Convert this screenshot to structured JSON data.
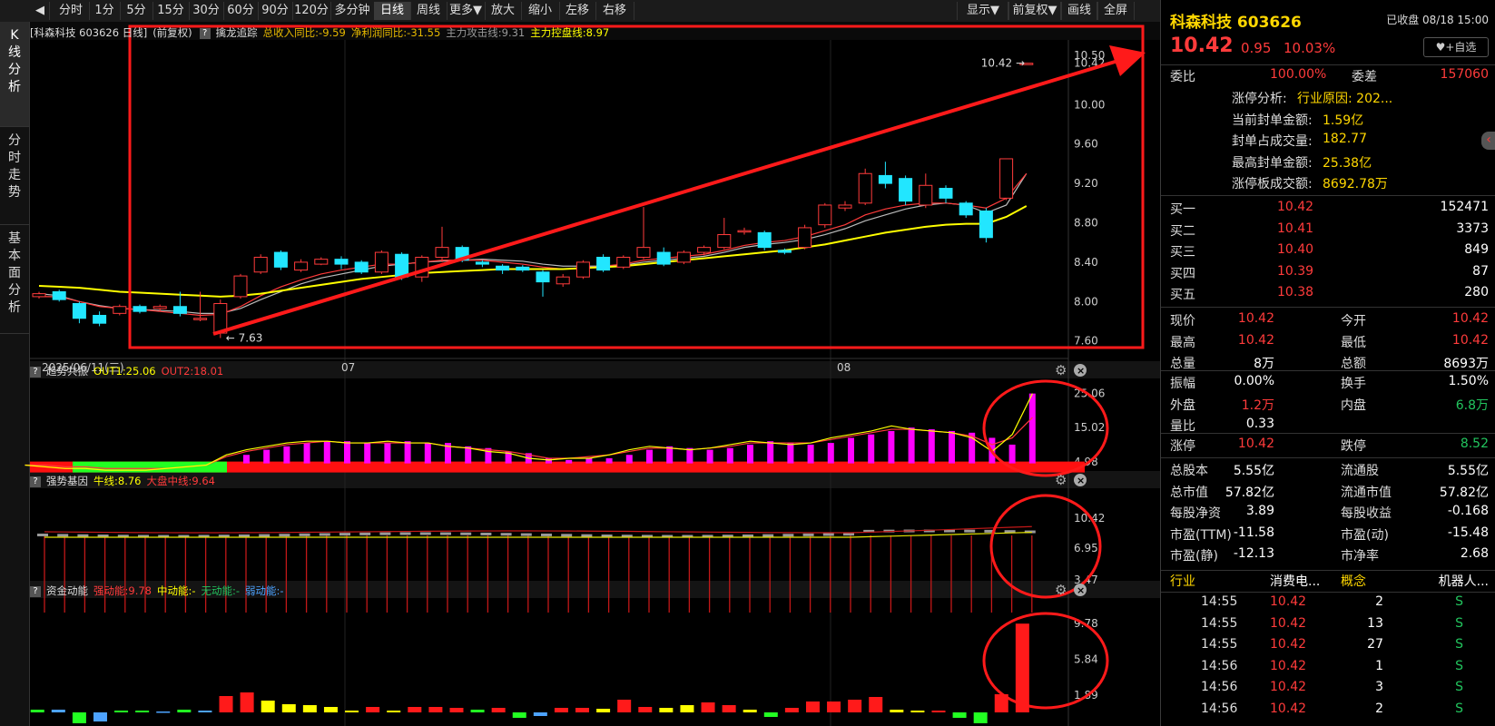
{
  "toolbar": {
    "back_icon": "◀",
    "items": [
      "分时",
      "1分",
      "5分",
      "15分",
      "30分",
      "60分",
      "90分",
      "120分",
      "多分钟",
      "日线",
      "周线",
      "更多▼",
      "放大",
      "缩小",
      "左移",
      "右移"
    ],
    "active": "日线",
    "right_items": [
      "显示▼",
      "前复权▼",
      "画线",
      "全屏"
    ]
  },
  "sidenav": {
    "items": [
      "K线分析",
      "分时走势",
      "基本面分析"
    ]
  },
  "kline": {
    "header": {
      "name": "[科森科技 603626 日线]",
      "fq": "(前复权)",
      "help": "?",
      "indicator": "擒龙追踪",
      "fields": [
        {
          "label": "总收入同比:",
          "value": "-9.59",
          "color": "#e6b800"
        },
        {
          "label": "净利润同比:",
          "value": "-31.55",
          "color": "#e6b800"
        },
        {
          "label": "主力攻击线:",
          "value": "9.31",
          "color": "#999999"
        },
        {
          "label": "主力控盘线:",
          "value": "8.97",
          "color": "#ffff00"
        }
      ]
    },
    "y_ticks": [
      "10.50",
      "10.42",
      "10.00",
      "9.60",
      "9.20",
      "8.80",
      "8.40",
      "8.00",
      "7.60"
    ],
    "x_labels": [
      "2025/06/11(三)",
      "07",
      "08"
    ],
    "max_label": "10.42",
    "min_label": "7.63",
    "ylim": [
      7.45,
      10.62
    ],
    "candles": [
      [
        8.05,
        8.08,
        8.03,
        8.1
      ],
      [
        8.1,
        8.02,
        8.0,
        8.12
      ],
      [
        7.98,
        7.83,
        7.78,
        8.0
      ],
      [
        7.86,
        7.78,
        7.75,
        7.9
      ],
      [
        7.88,
        7.95,
        7.86,
        7.97
      ],
      [
        7.95,
        7.9,
        7.88,
        7.97
      ],
      [
        7.93,
        7.95,
        7.9,
        7.97
      ],
      [
        7.95,
        7.88,
        7.85,
        8.1
      ],
      [
        7.82,
        7.83,
        7.8,
        8.1
      ],
      [
        7.68,
        7.98,
        7.63,
        8.02
      ],
      [
        8.05,
        8.26,
        8.03,
        8.28
      ],
      [
        8.3,
        8.45,
        8.28,
        8.48
      ],
      [
        8.5,
        8.35,
        8.32,
        8.52
      ],
      [
        8.32,
        8.4,
        8.3,
        8.43
      ],
      [
        8.38,
        8.43,
        8.37,
        8.45
      ],
      [
        8.43,
        8.38,
        8.33,
        8.46
      ],
      [
        8.4,
        8.3,
        8.28,
        8.42
      ],
      [
        8.3,
        8.5,
        8.28,
        8.52
      ],
      [
        8.48,
        8.25,
        8.22,
        8.5
      ],
      [
        8.25,
        8.45,
        8.2,
        8.47
      ],
      [
        8.45,
        8.55,
        8.4,
        8.76
      ],
      [
        8.55,
        8.42,
        8.4,
        8.57
      ],
      [
        8.4,
        8.38,
        8.35,
        8.42
      ],
      [
        8.36,
        8.32,
        8.28,
        8.38
      ],
      [
        8.35,
        8.32,
        8.3,
        8.37
      ],
      [
        8.3,
        8.2,
        8.05,
        8.32
      ],
      [
        8.18,
        8.25,
        8.15,
        8.28
      ],
      [
        8.25,
        8.4,
        8.23,
        8.42
      ],
      [
        8.45,
        8.32,
        8.3,
        8.48
      ],
      [
        8.35,
        8.45,
        8.33,
        8.47
      ],
      [
        8.45,
        8.55,
        8.43,
        8.96
      ],
      [
        8.5,
        8.38,
        8.36,
        8.55
      ],
      [
        8.4,
        8.5,
        8.38,
        8.52
      ],
      [
        8.5,
        8.55,
        8.47,
        8.57
      ],
      [
        8.55,
        8.68,
        8.53,
        8.85
      ],
      [
        8.72,
        8.72,
        8.68,
        8.75
      ],
      [
        8.7,
        8.55,
        8.52,
        8.72
      ],
      [
        8.52,
        8.5,
        8.48,
        8.54
      ],
      [
        8.55,
        8.75,
        8.53,
        8.78
      ],
      [
        8.78,
        8.98,
        8.75,
        9.0
      ],
      [
        8.95,
        8.98,
        8.92,
        9.02
      ],
      [
        9.0,
        9.3,
        8.98,
        9.35
      ],
      [
        9.28,
        9.2,
        9.15,
        9.42
      ],
      [
        9.25,
        9.02,
        8.98,
        9.28
      ],
      [
        8.98,
        9.18,
        8.95,
        9.3
      ],
      [
        9.15,
        9.05,
        9.0,
        9.18
      ],
      [
        9.0,
        8.88,
        8.85,
        9.02
      ],
      [
        8.92,
        8.65,
        8.6,
        8.95
      ],
      [
        9.05,
        9.45,
        9.03,
        9.45
      ],
      [
        10.42,
        10.42,
        10.42,
        10.42
      ]
    ],
    "ma_white": [
      8.08,
      8.06,
      8.0,
      7.96,
      7.93,
      7.92,
      7.91,
      7.9,
      7.88,
      7.88,
      7.93,
      8.02,
      8.1,
      8.18,
      8.24,
      8.28,
      8.32,
      8.36,
      8.38,
      8.4,
      8.41,
      8.42,
      8.43,
      8.42,
      8.41,
      8.38,
      8.36,
      8.36,
      8.36,
      8.37,
      8.4,
      8.42,
      8.44,
      8.46,
      8.5,
      8.55,
      8.58,
      8.6,
      8.63,
      8.68,
      8.74,
      8.82,
      8.88,
      8.94,
      8.98,
      9.0,
      8.98,
      8.9,
      8.98,
      9.3
    ],
    "ma_red": [
      8.05,
      8.05,
      8.0,
      7.95,
      7.93,
      7.92,
      7.9,
      7.88,
      7.86,
      7.87,
      7.95,
      8.06,
      8.15,
      8.22,
      8.28,
      8.32,
      8.35,
      8.38,
      8.38,
      8.4,
      8.42,
      8.42,
      8.42,
      8.4,
      8.38,
      8.35,
      8.33,
      8.34,
      8.36,
      8.38,
      8.42,
      8.44,
      8.46,
      8.48,
      8.52,
      8.57,
      8.6,
      8.62,
      8.66,
      8.72,
      8.78,
      8.88,
      8.94,
      8.98,
      9.0,
      9.0,
      8.98,
      8.95,
      9.05,
      9.3
    ],
    "ma_yellow": [
      8.16,
      8.15,
      8.14,
      8.12,
      8.1,
      8.09,
      8.08,
      8.07,
      8.06,
      8.05,
      8.06,
      8.08,
      8.11,
      8.14,
      8.17,
      8.2,
      8.23,
      8.25,
      8.27,
      8.29,
      8.3,
      8.31,
      8.32,
      8.33,
      8.33,
      8.33,
      8.33,
      8.34,
      8.35,
      8.36,
      8.38,
      8.4,
      8.42,
      8.44,
      8.46,
      8.48,
      8.5,
      8.52,
      8.55,
      8.58,
      8.62,
      8.66,
      8.7,
      8.73,
      8.76,
      8.78,
      8.79,
      8.79,
      8.86,
      8.97
    ]
  },
  "panel2": {
    "help": "?",
    "title": "趋势共振",
    "fields": [
      {
        "label": "OUT1:",
        "value": "25.06",
        "color": "#ffff00"
      },
      {
        "label": "OUT2:",
        "value": "18.01",
        "color": "#ff3b3b"
      }
    ],
    "y_ticks": [
      "25.06",
      "15.02",
      "4.98"
    ],
    "ylim": [
      2,
      26.5
    ],
    "bars": [
      4,
      4,
      4,
      4,
      4,
      4,
      4,
      4,
      4,
      4,
      7,
      8.5,
      9.5,
      10.5,
      11,
      11,
      10.5,
      10.5,
      11,
      10.5,
      10.5,
      9.5,
      9,
      8,
      7.5,
      6,
      5.5,
      6,
      6,
      7,
      8.5,
      9.5,
      9,
      8.5,
      9,
      10,
      11,
      10.5,
      10,
      10.5,
      12,
      13,
      14,
      15,
      14.5,
      14,
      13.5,
      12,
      10,
      25
    ],
    "out1": [
      4,
      3.5,
      3,
      3,
      2.5,
      2.5,
      2.5,
      3,
      3.5,
      4,
      7,
      8.5,
      9.5,
      10.5,
      11,
      11,
      10.5,
      10.5,
      11,
      10.5,
      10.5,
      9.5,
      9,
      8,
      7.5,
      6,
      5.5,
      6,
      6,
      7,
      8.5,
      9.5,
      9,
      8.5,
      9,
      10,
      11,
      10.5,
      10,
      10.5,
      12,
      13,
      14,
      15.5,
      14.5,
      14,
      13.5,
      12,
      8,
      13,
      25
    ],
    "out2": [
      4,
      4,
      3.5,
      3.5,
      3,
      3,
      3,
      3,
      3.5,
      4,
      6.5,
      8,
      9,
      10,
      10.5,
      11,
      10.5,
      10.5,
      10.5,
      10.5,
      10.5,
      9.5,
      9,
      8.5,
      8,
      7,
      6,
      6,
      6.5,
      7,
      8,
      9,
      9,
      8.5,
      9,
      9.5,
      10.5,
      10.5,
      10.5,
      10.5,
      11.5,
      12.5,
      13.5,
      14.5,
      14.5,
      14,
      13.5,
      12.5,
      10,
      12,
      18
    ]
  },
  "panel3": {
    "help": "?",
    "title": "强势基因",
    "fields": [
      {
        "label": "牛线:",
        "value": "8.76",
        "color": "#ffff00"
      },
      {
        "label": "大盘中线:",
        "value": "9.64",
        "color": "#ff3b3b"
      }
    ],
    "y_ticks": [
      "10.42",
      "6.95",
      "3.47"
    ]
  },
  "panel4": {
    "help": "?",
    "title": "资金动能",
    "fields": [
      {
        "label": "强动能:",
        "value": "9.78",
        "color": "#ff3b3b"
      },
      {
        "label": "中动能:",
        "value": "-",
        "color": "#ffff00"
      },
      {
        "label": "无动能:",
        "value": "-",
        "color": "#22c55e"
      },
      {
        "label": "弱动能:",
        "value": "-",
        "color": "#4da3ff"
      }
    ],
    "y_ticks": [
      "9.78",
      "5.84",
      "1.89"
    ],
    "ylim": [
      -1.5,
      10
    ],
    "bars": [
      [
        0.3,
        "g"
      ],
      [
        0.3,
        "b"
      ],
      [
        -1.2,
        "g"
      ],
      [
        -1,
        "b"
      ],
      [
        0.2,
        "g"
      ],
      [
        0.2,
        "g"
      ],
      [
        0.1,
        "b"
      ],
      [
        0.3,
        "g"
      ],
      [
        0.2,
        "b"
      ],
      [
        1.8,
        "r"
      ],
      [
        2.2,
        "r"
      ],
      [
        1.3,
        "y"
      ],
      [
        0.9,
        "y"
      ],
      [
        0.8,
        "y"
      ],
      [
        0.6,
        "y"
      ],
      [
        0.2,
        "y"
      ],
      [
        0.6,
        "r"
      ],
      [
        0.2,
        "y"
      ],
      [
        0.6,
        "r"
      ],
      [
        0.6,
        "r"
      ],
      [
        0.5,
        "r"
      ],
      [
        0.3,
        "g"
      ],
      [
        0.5,
        "r"
      ],
      [
        -0.6,
        "g"
      ],
      [
        -0.4,
        "b"
      ],
      [
        0.5,
        "r"
      ],
      [
        0.5,
        "r"
      ],
      [
        0.4,
        "y"
      ],
      [
        1.4,
        "r"
      ],
      [
        0.6,
        "r"
      ],
      [
        0.5,
        "y"
      ],
      [
        0.8,
        "y"
      ],
      [
        1.1,
        "r"
      ],
      [
        0.8,
        "r"
      ],
      [
        0.3,
        "y"
      ],
      [
        -0.5,
        "g"
      ],
      [
        0.5,
        "r"
      ],
      [
        1.2,
        "r"
      ],
      [
        1.2,
        "r"
      ],
      [
        1.4,
        "r"
      ],
      [
        1.7,
        "r"
      ],
      [
        0.3,
        "y"
      ],
      [
        0.2,
        "y"
      ],
      [
        0.2,
        "r"
      ],
      [
        -0.6,
        "g"
      ],
      [
        -1.2,
        "g"
      ],
      [
        2.0,
        "r"
      ],
      [
        9.78,
        "r"
      ]
    ]
  },
  "right": {
    "name": "科森科技 603626",
    "status": "已收盘 08/18 15:00",
    "price": "10.42",
    "change": "0.95",
    "pct": "10.03%",
    "fav": "♥+自选",
    "weibi_label": "委比",
    "weibi": "100.00%",
    "weicha_label": "委差",
    "weicha": "157060",
    "zt": [
      {
        "l": "涨停分析:",
        "v": "行业原因: 202..."
      },
      {
        "l": "当前封单金额:",
        "v": "1.59亿"
      },
      {
        "l": "封单占成交量:",
        "v": "182.77"
      },
      {
        "l": "最高封单金额:",
        "v": "25.38亿"
      },
      {
        "l": "涨停板成交额:",
        "v": "8692.78万"
      }
    ],
    "bids": [
      {
        "l": "买一",
        "p": "10.42",
        "v": "152471"
      },
      {
        "l": "买二",
        "p": "10.41",
        "v": "3373"
      },
      {
        "l": "买三",
        "p": "10.40",
        "v": "849"
      },
      {
        "l": "买四",
        "p": "10.39",
        "v": "87"
      },
      {
        "l": "买五",
        "p": "10.38",
        "v": "280"
      }
    ],
    "stats1": [
      [
        "现价",
        "10.42",
        "red",
        "今开",
        "10.42",
        "red"
      ],
      [
        "最高",
        "10.42",
        "red",
        "最低",
        "10.42",
        "red"
      ],
      [
        "总量",
        "8万",
        "wht",
        "总额",
        "8693万",
        "wht"
      ]
    ],
    "stats2": [
      [
        "振幅",
        "0.00%",
        "wht",
        "换手",
        "1.50%",
        "wht"
      ],
      [
        "外盘",
        "1.2万",
        "red",
        "内盘",
        "6.8万",
        "green"
      ],
      [
        "量比",
        "0.33",
        "wht",
        "",
        "",
        " "
      ]
    ],
    "stats3": [
      [
        "涨停",
        "10.42",
        "red",
        "跌停",
        "8.52",
        "green"
      ]
    ],
    "stats4": [
      [
        "总股本",
        "5.55亿",
        "wht",
        "流通股",
        "5.55亿",
        "wht"
      ],
      [
        "总市值",
        "57.82亿",
        "wht",
        "流通市值",
        "57.82亿",
        "wht"
      ],
      [
        "每股净资",
        "3.89",
        "wht",
        "每股收益",
        "-0.168",
        "wht"
      ],
      [
        "市盈(TTM)",
        "-11.58",
        "wht",
        "市盈(动)",
        "-15.48",
        "wht"
      ],
      [
        "市盈(静)",
        "-12.13",
        "wht",
        "市净率",
        "2.68",
        "wht"
      ]
    ],
    "industry": {
      "l1": "行业",
      "v1": "消费电...",
      "l2": "概念",
      "v2": "机器人..."
    },
    "ticks": [
      [
        "14:55",
        "10.42",
        "2",
        "S"
      ],
      [
        "14:55",
        "10.42",
        "13",
        "S"
      ],
      [
        "14:55",
        "10.42",
        "27",
        "S"
      ],
      [
        "14:56",
        "10.42",
        "1",
        "S"
      ],
      [
        "14:56",
        "10.42",
        "3",
        "S"
      ],
      [
        "14:56",
        "10.42",
        "2",
        "S"
      ]
    ],
    "side_arrow": "‹"
  }
}
